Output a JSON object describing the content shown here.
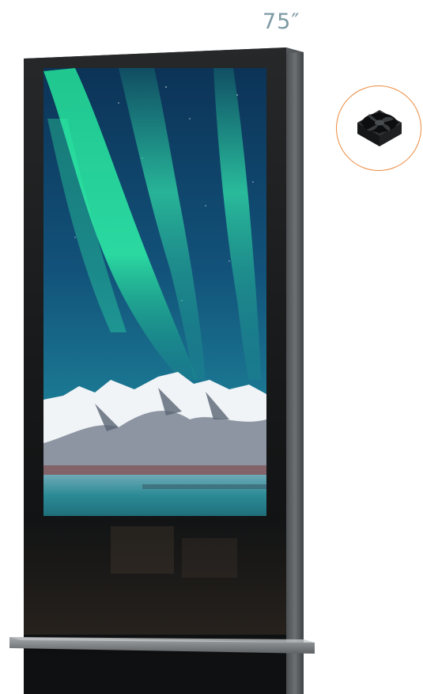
{
  "product": {
    "size_label": "75″"
  },
  "badge": {
    "icon": "cooling-fan-icon",
    "border_color": "#ec8a3e"
  },
  "colors": {
    "frame": "#1a1c1d",
    "side_panel": "#5b5f61",
    "aurora": "#2ee6a0",
    "sky": "#0e3f6e",
    "shelf": "#8a8d8f"
  }
}
